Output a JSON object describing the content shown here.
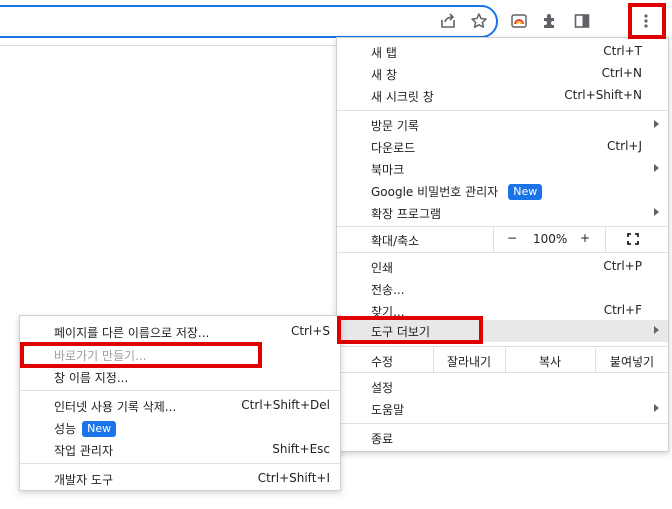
{
  "main_menu": {
    "group1": [
      {
        "label": "새 탭",
        "shortcut": "Ctrl+T"
      },
      {
        "label": "새 창",
        "shortcut": "Ctrl+N"
      },
      {
        "label": "새 시크릿 창",
        "shortcut": "Ctrl+Shift+N"
      }
    ],
    "group2": [
      {
        "label": "방문 기록",
        "submenu": true
      },
      {
        "label": "다운로드",
        "shortcut": "Ctrl+J"
      },
      {
        "label": "북마크",
        "submenu": true
      },
      {
        "label": "Google 비밀번호 관리자",
        "badge": "New"
      },
      {
        "label": "확장 프로그램",
        "submenu": true
      }
    ],
    "zoom": {
      "label": "확대/축소",
      "minus": "−",
      "value": "100%",
      "plus": "+"
    },
    "group3": [
      {
        "label": "인쇄",
        "shortcut": "Ctrl+P"
      },
      {
        "label": "전송..."
      },
      {
        "label": "찾기...",
        "shortcut": "Ctrl+F"
      },
      {
        "label": "도구 더보기",
        "submenu": true,
        "active": true
      }
    ],
    "edit": {
      "label": "수정",
      "cut": "잘라내기",
      "copy": "복사",
      "paste": "붙여넣기"
    },
    "group4": [
      {
        "label": "설정"
      },
      {
        "label": "도움말",
        "submenu": true
      }
    ],
    "exit": {
      "label": "종료"
    }
  },
  "sub_menu": {
    "group1": [
      {
        "label": "페이지를 다른 이름으로 저장...",
        "shortcut": "Ctrl+S"
      },
      {
        "label": "바로가기 만들기...",
        "disabled": true
      },
      {
        "label": "창 이름 지정..."
      }
    ],
    "group2": [
      {
        "label": "인터넷 사용 기록 삭제...",
        "shortcut": "Ctrl+Shift+Del"
      },
      {
        "label": "성능",
        "badge": "New"
      },
      {
        "label": "작업 관리자",
        "shortcut": "Shift+Esc"
      }
    ],
    "group3": [
      {
        "label": "개발자 도구",
        "shortcut": "Ctrl+Shift+I"
      }
    ]
  },
  "colors": {
    "accent": "#1a73e8",
    "highlight": "#e00000",
    "active_bg": "#e8e8e8"
  }
}
